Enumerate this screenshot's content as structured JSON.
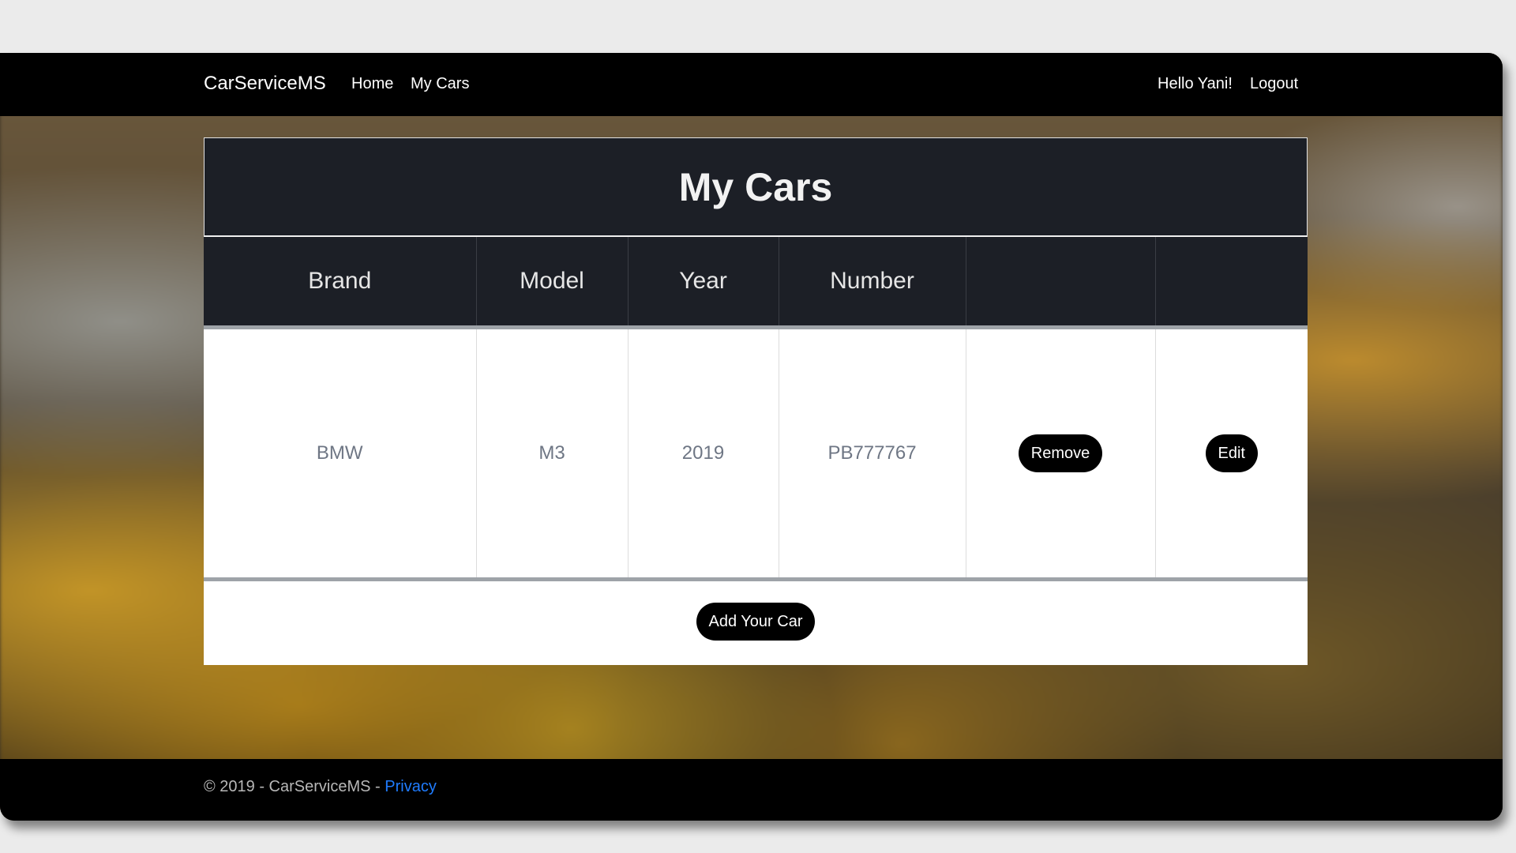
{
  "navbar": {
    "brand": "CarServiceMS",
    "links": [
      {
        "label": "Home"
      },
      {
        "label": "My Cars"
      }
    ],
    "greeting": "Hello Yani!",
    "logout": "Logout"
  },
  "main": {
    "title": "My Cars",
    "table": {
      "headers": [
        "Brand",
        "Model",
        "Year",
        "Number",
        "",
        ""
      ],
      "rows": [
        {
          "brand": "BMW",
          "model": "M3",
          "year": "2019",
          "number": "PB777767",
          "remove_label": "Remove",
          "edit_label": "Edit"
        }
      ]
    },
    "add_button": "Add Your Car"
  },
  "footer": {
    "copyright": "© 2019 - CarServiceMS - ",
    "privacy_link": "Privacy"
  },
  "colors": {
    "navbar_bg": "#000000",
    "card_header_bg": "#1c1f26",
    "button_bg": "#000000",
    "link": "#1f7cff"
  }
}
